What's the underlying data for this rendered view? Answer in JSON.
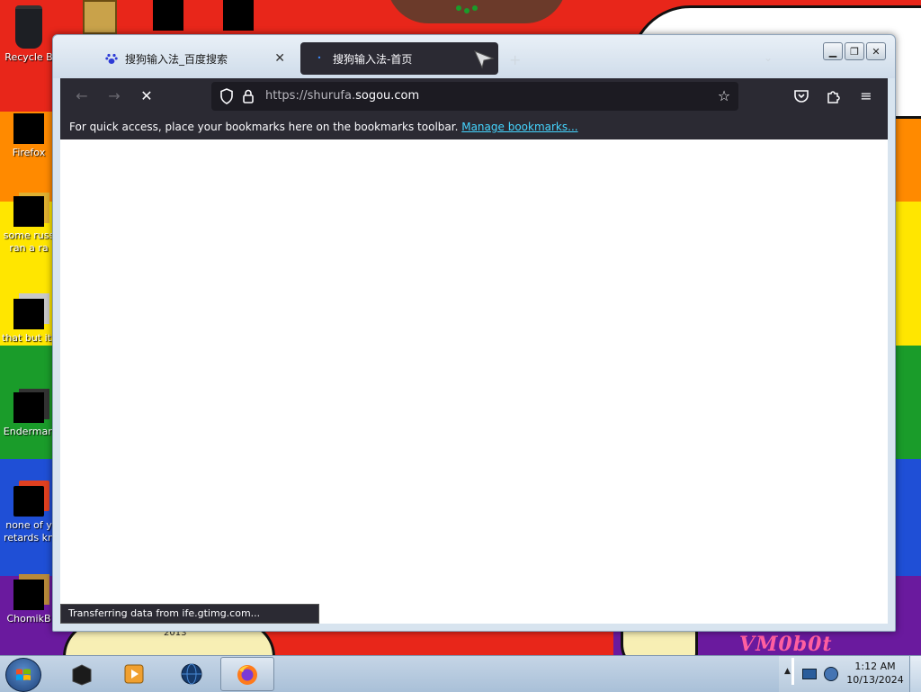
{
  "desktop": {
    "icons": [
      {
        "label": "Recycle B"
      },
      {
        "label": "Firefox"
      },
      {
        "label": "some russ",
        "label2": "ran a ra"
      },
      {
        "label": "that but its"
      },
      {
        "label": "Enderman"
      },
      {
        "label": "none of y",
        "label2": "retards kn"
      },
      {
        "label": "ChomikB"
      }
    ],
    "wallpaper_year": "2013",
    "wallpaper_signature": "VM0b0t"
  },
  "browser": {
    "tabs": [
      {
        "title": "搜狗输入法_百度搜索",
        "icon": "baidu-paw-icon"
      },
      {
        "title": "搜狗输入法-首页",
        "icon": "loading-dot-icon"
      }
    ],
    "url": {
      "prefix": "https://shurufa.",
      "host": "sogou.com"
    },
    "bookmarks_bar": {
      "message": "For quick access, place your bookmarks here on the bookmarks toolbar. ",
      "link": "Manage bookmarks..."
    },
    "status": "Transferring data from ife.gtimg.com..."
  },
  "taskbar": {
    "time": "1:12 AM",
    "date": "10/13/2024"
  },
  "colors": {
    "firefox_toolbar": "#2b2a33",
    "urlbar": "#1c1b22",
    "link": "#45d5ff",
    "wallpaper_stripes": [
      "#e8261a",
      "#ff8a00",
      "#ffe600",
      "#1a9c2a",
      "#1f4fd6",
      "#6a1a9e"
    ]
  }
}
